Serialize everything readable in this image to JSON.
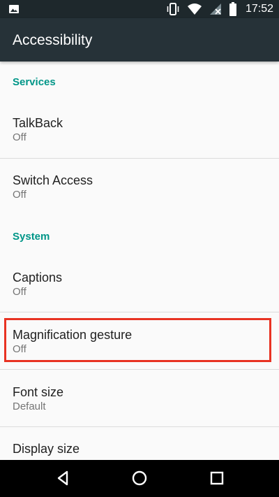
{
  "status_bar": {
    "time": "17:52",
    "left_icon": "image-icon",
    "icons": [
      "vibrate-icon",
      "wifi-icon",
      "no-signal-icon",
      "battery-icon"
    ]
  },
  "app_bar": {
    "title": "Accessibility"
  },
  "sections": [
    {
      "header": "Services",
      "items": [
        {
          "title": "TalkBack",
          "summary": "Off"
        },
        {
          "title": "Switch Access",
          "summary": "Off"
        }
      ]
    },
    {
      "header": "System",
      "items": [
        {
          "title": "Captions",
          "summary": "Off"
        },
        {
          "title": "Magnification gesture",
          "summary": "Off"
        },
        {
          "title": "Font size",
          "summary": "Default"
        },
        {
          "title": "Display size",
          "summary": ""
        }
      ]
    }
  ],
  "colors": {
    "status_bar": "#1e282c",
    "app_bar": "#263238",
    "section_header": "#009688",
    "highlight": "#e83323",
    "nav_bar": "#000000"
  },
  "nav_bar": {
    "icons": [
      "back-icon",
      "home-icon",
      "recents-icon"
    ]
  }
}
